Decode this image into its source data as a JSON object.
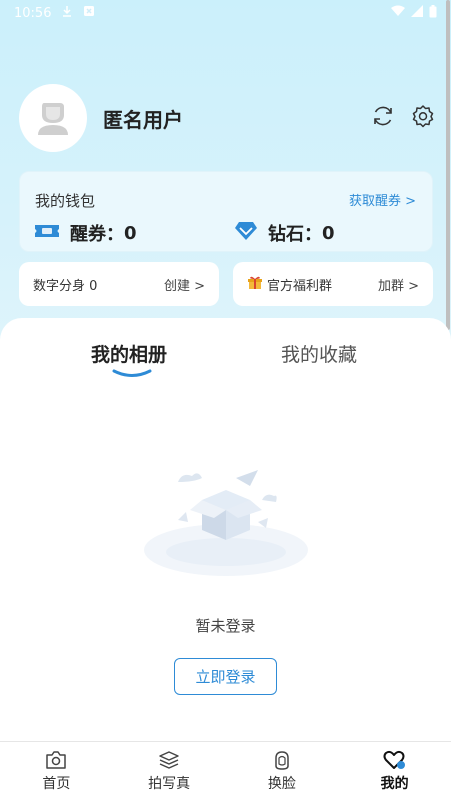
{
  "status_bar": {
    "time": "10:56"
  },
  "profile": {
    "username": "匿名用户"
  },
  "wallet": {
    "title": "我的钱包",
    "link": "获取醒券 >",
    "coupon_label": "醒券：",
    "coupon_value": "0",
    "diamond_label": "钻石：",
    "diamond_value": "0"
  },
  "cards": {
    "avatar_label": "数字分身 0",
    "avatar_action": "创建 >",
    "group_label": "官方福利群",
    "group_action": "加群 >"
  },
  "tabs": {
    "album": "我的相册",
    "favorites": "我的收藏"
  },
  "empty": {
    "message": "暂未登录",
    "login_button": "立即登录"
  },
  "nav": {
    "items": [
      {
        "label": "首页",
        "icon": "camera-icon"
      },
      {
        "label": "拍写真",
        "icon": "layers-icon"
      },
      {
        "label": "换脸",
        "icon": "face-icon"
      },
      {
        "label": "我的",
        "icon": "heart-icon"
      }
    ]
  },
  "colors": {
    "accent": "#2e8bd6",
    "bg": "#cfeef9"
  }
}
